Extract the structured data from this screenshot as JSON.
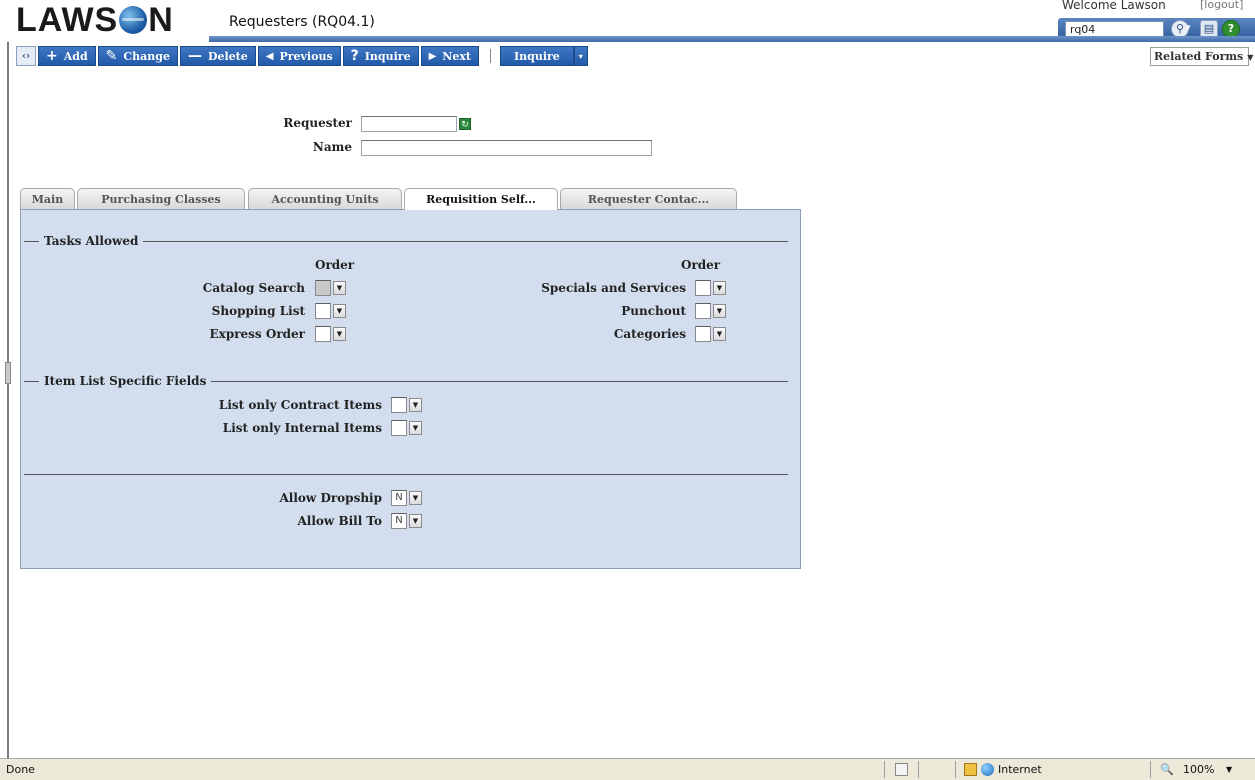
{
  "header": {
    "logo_text_left": "LAWS",
    "logo_text_right": "N",
    "form_title": "Requesters (RQ04.1)",
    "welcome": "Welcome Lawson",
    "logout": "[logout]",
    "search_value": "rq04",
    "accent": "#3d6aa8"
  },
  "toolbar": {
    "add": "Add",
    "change": "Change",
    "delete": "Delete",
    "previous": "Previous",
    "inquire": "Inquire",
    "next": "Next",
    "inquire2": "Inquire",
    "related_forms": "Related Forms"
  },
  "form": {
    "requester_label": "Requester",
    "requester_value": "",
    "name_label": "Name",
    "name_value": ""
  },
  "tabs": [
    {
      "label": "Main"
    },
    {
      "label": "Purchasing Classes"
    },
    {
      "label": "Accounting Units"
    },
    {
      "label": "Requisition Self..."
    },
    {
      "label": "Requester Contac..."
    }
  ],
  "active_tab": "Requisition Self...",
  "panel": {
    "tasks_title": "Tasks Allowed",
    "order_left": "Order",
    "order_right": "Order",
    "tasks_left": [
      {
        "label": "Catalog Search",
        "value": ""
      },
      {
        "label": "Shopping List",
        "value": ""
      },
      {
        "label": "Express Order",
        "value": ""
      }
    ],
    "tasks_right": [
      {
        "label": "Specials and Services",
        "value": ""
      },
      {
        "label": "Punchout",
        "value": ""
      },
      {
        "label": "Categories",
        "value": ""
      }
    ],
    "item_list_title": "Item List Specific Fields",
    "item_list": [
      {
        "label": "List only Contract Items",
        "value": ""
      },
      {
        "label": "List only Internal Items",
        "value": ""
      }
    ],
    "other": [
      {
        "label": "Allow Dropship",
        "value": "N"
      },
      {
        "label": "Allow Bill To",
        "value": "N"
      }
    ]
  },
  "statusbar": {
    "status": "Done",
    "zone": "Internet",
    "zoom": "100%"
  }
}
